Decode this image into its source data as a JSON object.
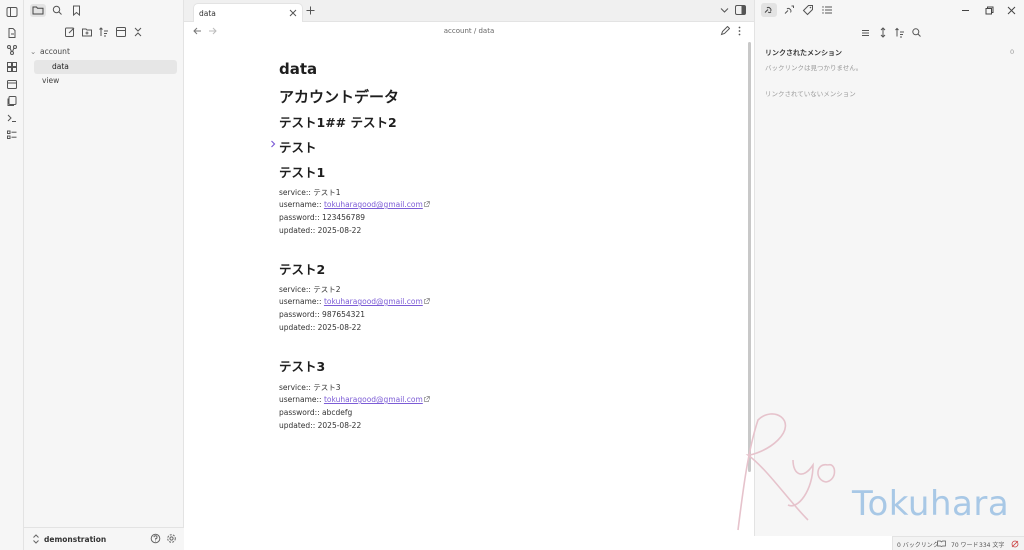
{
  "tab": {
    "title": "data"
  },
  "breadcrumb": {
    "text": "account / data"
  },
  "explorer": {
    "folder": "account",
    "file": "data",
    "other": "view",
    "vault_name": "demonstration"
  },
  "note": {
    "title": "data",
    "heading_account": "アカウントデータ",
    "heading_mixed": "テスト1## テスト2",
    "heading_test": "テスト",
    "entries": [
      {
        "heading": "テスト1",
        "service": "service:: テスト1",
        "username_label": "username:: ",
        "username": "tokuharagood@gmail.com",
        "password": "password:: 123456789",
        "updated": "updated:: 2025-08-22"
      },
      {
        "heading": "テスト2",
        "service": "service:: テスト2",
        "username_label": "username:: ",
        "username": "tokuharagood@gmail.com",
        "password": "password:: 987654321",
        "updated": "updated:: 2025-08-22"
      },
      {
        "heading": "テスト3",
        "service": "service:: テスト3",
        "username_label": "username:: ",
        "username": "tokuharagood@gmail.com",
        "password": "password:: abcdefg",
        "updated": "updated:: 2025-08-22"
      }
    ]
  },
  "backlinks": {
    "linked_title": "リンクされたメンション",
    "linked_count": "0",
    "none_text": "バックリンクは見つかりません。",
    "unlinked_title": "リンクされていないメンション"
  },
  "watermark": {
    "signature": "Ryo",
    "name": "Tokuhara"
  },
  "status": {
    "backlinks": "0 バックリンク",
    "words": "70 ワード",
    "chars": "334 文字"
  },
  "colors": {
    "accent": "#7c5cd6",
    "watermark_blue": "#a8c8e6",
    "watermark_pink": "#e6c3cc"
  }
}
